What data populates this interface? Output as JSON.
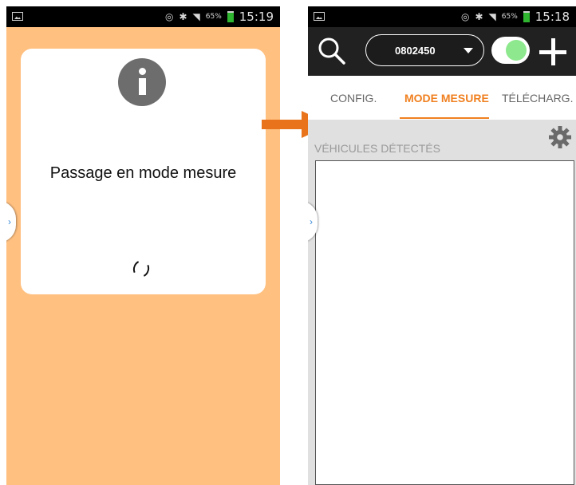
{
  "status_bar": {
    "left_time": "15:19",
    "left_battery": "65%",
    "right_time": "15:18",
    "right_battery": "65%"
  },
  "dialog": {
    "message": "Passage en mode mesure",
    "icon": "info-icon"
  },
  "app_bar": {
    "device_id": "0802450",
    "toggle_on": true,
    "search_icon": "search-icon",
    "add_icon": "plus-icon"
  },
  "tabs": [
    {
      "label": "CONFIG.",
      "active": false
    },
    {
      "label": "MODE MESURE",
      "active": true
    },
    {
      "label": "TÉLÉCHARG.",
      "active": false
    }
  ],
  "content": {
    "section_title": "VÉHICULES DÉTECTÉS",
    "settings_icon": "gear-icon"
  },
  "colors": {
    "accent": "#f08020",
    "left_background": "#ffc080",
    "toggle_green": "#8ee88e"
  }
}
